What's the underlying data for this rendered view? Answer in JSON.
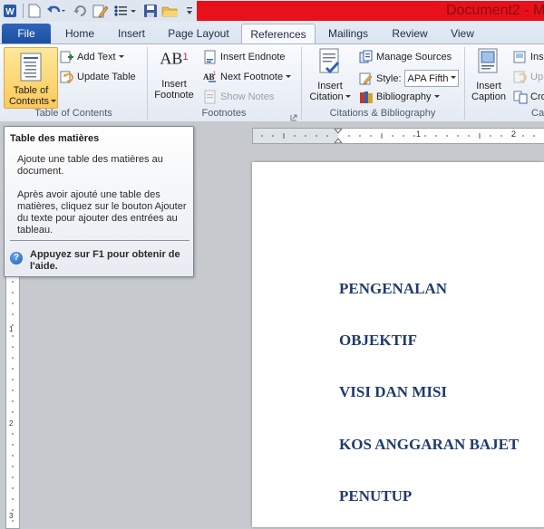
{
  "title_bar": {
    "document_title": "Document2 - M",
    "qat_icons": [
      "word-logo",
      "new-document",
      "undo",
      "redo",
      "edit-document",
      "bullets",
      "save",
      "open-folder",
      "customize-qat"
    ]
  },
  "tabs": {
    "file": "File",
    "home": "Home",
    "insert": "Insert",
    "page_layout": "Page Layout",
    "references": "References",
    "mailings": "Mailings",
    "review": "Review",
    "view": "View"
  },
  "ribbon": {
    "toc_group": {
      "label": "Table of Contents",
      "toc_button_line1": "Table of",
      "toc_button_line2": "Contents",
      "add_text": "Add Text",
      "update_table": "Update Table"
    },
    "footnotes_group": {
      "label": "Footnotes",
      "insert_footnote_line1": "Insert",
      "insert_footnote_line2": "Footnote",
      "insert_endnote": "Insert Endnote",
      "next_footnote": "Next Footnote",
      "show_notes": "Show Notes",
      "ab_glyph": "AB",
      "ab_superscript": "1"
    },
    "citations_group": {
      "label": "Citations & Bibliography",
      "insert_citation_line1": "Insert",
      "insert_citation_line2": "Citation",
      "manage_sources": "Manage Sources",
      "style_label": "Style:",
      "style_value": "APA Fifth",
      "bibliography": "Bibliography"
    },
    "captions_group": {
      "label": "Ca",
      "insert_caption_line1": "Insert",
      "insert_caption_line2": "Caption",
      "insert_table_of_figures": "Ins",
      "update_table": "Up",
      "cross_reference": "Cro"
    }
  },
  "tooltip": {
    "title": "Table des matières",
    "para1": "Ajoute une table des matières au document.",
    "para2": "Après avoir ajouté une table des matières, cliquez sur le bouton Ajouter du texte pour ajouter des entrées au tableau.",
    "help": "Appuyez sur F1 pour obtenir de l'aide.",
    "help_icon_glyph": "?"
  },
  "ruler": {
    "tick_labels": [
      "1",
      "2"
    ],
    "left_labels": [
      "1",
      "2",
      "3"
    ]
  },
  "document": {
    "headings": [
      "PENGENALAN",
      "OBJEKTIF",
      "VISI DAN MISI",
      "KOS ANGGARAN BAJET",
      "PENUTUP"
    ],
    "heading_color": "#1f3a6e"
  }
}
